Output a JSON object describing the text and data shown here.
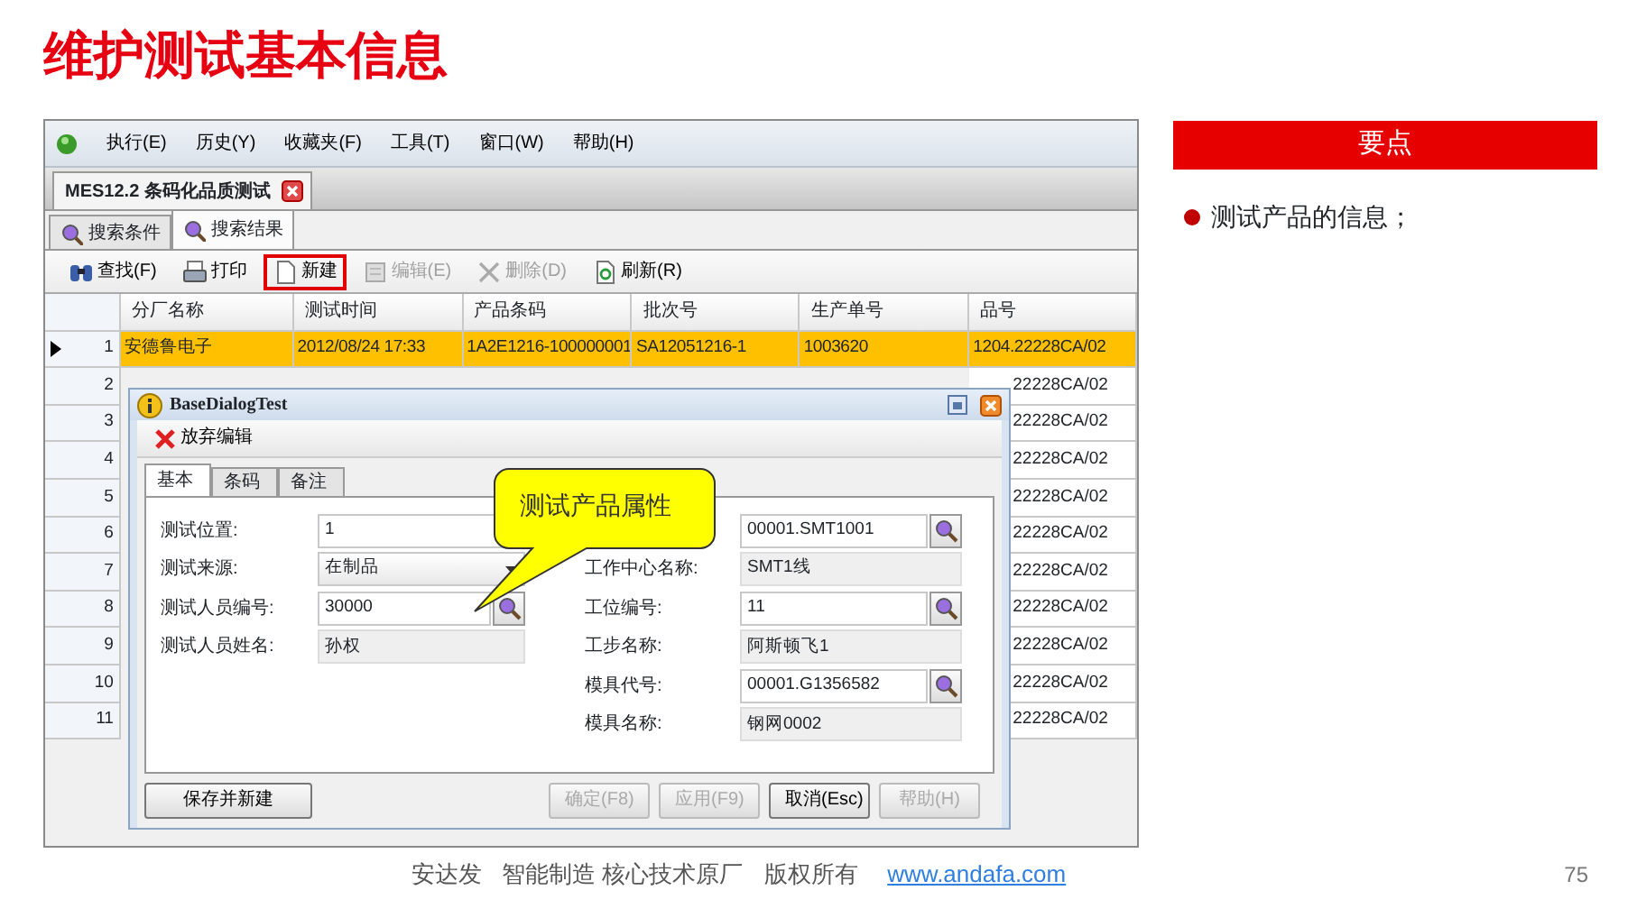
{
  "slide_title": "维护测试基本信息",
  "app": {
    "menu": [
      "执行(E)",
      "历史(Y)",
      "收藏夹(F)",
      "工具(T)",
      "窗口(W)",
      "帮助(H)"
    ],
    "document_tab": "MES12.2 条码化品质测试",
    "tabs": [
      {
        "label": "搜索条件",
        "selected": false
      },
      {
        "label": "搜索结果",
        "selected": true
      }
    ],
    "toolbar": [
      {
        "kind": "find",
        "label": "查找(F)",
        "disabled": false,
        "highlighted": false
      },
      {
        "kind": "print",
        "label": "打印",
        "disabled": false,
        "highlighted": false
      },
      {
        "kind": "new",
        "label": "新建",
        "disabled": false,
        "highlighted": true
      },
      {
        "kind": "edit",
        "label": "编辑(E)",
        "disabled": true,
        "highlighted": false
      },
      {
        "kind": "delete",
        "label": "删除(D)",
        "disabled": true,
        "highlighted": false
      },
      {
        "kind": "refresh",
        "label": "刷新(R)",
        "disabled": false,
        "highlighted": false
      }
    ],
    "grid": {
      "columns": [
        "分厂名称",
        "测试时间",
        "产品条码",
        "批次号",
        "生产单号",
        "品号"
      ],
      "rows": [
        {
          "number": "1",
          "selected": true,
          "cells": [
            "安德鲁电子",
            "2012/08/24 17:33",
            "1A2E1216-100000001",
            "SA12051216-1",
            "1003620",
            "1204.22228CA/02"
          ]
        },
        {
          "number": "2",
          "selected": false,
          "part_number": "22228CA/02"
        },
        {
          "number": "3",
          "selected": false,
          "part_number": "22228CA/02"
        },
        {
          "number": "4",
          "selected": false,
          "part_number": "22228CA/02"
        },
        {
          "number": "5",
          "selected": false,
          "part_number": "22228CA/02"
        },
        {
          "number": "6",
          "selected": false,
          "part_number": "22228CA/02"
        },
        {
          "number": "7",
          "selected": false,
          "part_number": "22228CA/02"
        },
        {
          "number": "8",
          "selected": false,
          "part_number": "22228CA/02"
        },
        {
          "number": "9",
          "selected": false,
          "part_number": "22228CA/02"
        },
        {
          "number": "10",
          "selected": false,
          "part_number": "22228CA/02"
        },
        {
          "number": "11",
          "selected": false,
          "part_number": "22228CA/02"
        }
      ]
    },
    "dialog": {
      "title": "BaseDialogTest",
      "toolbar_button": "放弃编辑",
      "tabs": [
        {
          "label": "基本",
          "selected": true
        },
        {
          "label": "条码",
          "selected": false
        },
        {
          "label": "备注",
          "selected": false
        }
      ],
      "left_fields": [
        {
          "label": "测试位置:",
          "value": "1",
          "kind": "text"
        },
        {
          "label": "测试来源:",
          "value": "在制品",
          "kind": "select"
        },
        {
          "label": "测试人员编号:",
          "value": "30000",
          "kind": "lookup"
        },
        {
          "label": "测试人员姓名:",
          "value": "孙权",
          "kind": "readonly"
        }
      ],
      "right_fields": [
        {
          "value": "00001.SMT1001",
          "kind": "lookup"
        },
        {
          "label": "工作中心名称:",
          "value": "SMT1线",
          "kind": "readonly"
        },
        {
          "label": "工位编号:",
          "value": "11",
          "kind": "lookup"
        },
        {
          "label": "工步名称:",
          "value": "阿斯顿飞1",
          "kind": "readonly"
        },
        {
          "label": "模具代号:",
          "value": "00001.G1356582",
          "kind": "lookup"
        },
        {
          "label": "模具名称:",
          "value": "钢网0002",
          "kind": "readonly"
        }
      ],
      "buttons": [
        {
          "label": "保存并新建",
          "disabled": false
        },
        {
          "label": "确定(F8)",
          "disabled": true
        },
        {
          "label": "应用(F9)",
          "disabled": true
        },
        {
          "label": "取消(Esc)",
          "disabled": false
        },
        {
          "label": "帮助(H)",
          "disabled": true
        }
      ]
    },
    "callout": "测试产品属性"
  },
  "key_points": {
    "heading": "要点",
    "items": [
      "测试产品的信息；"
    ]
  },
  "footer": {
    "texts": [
      "安达发",
      "智能制造 核心技术原厂",
      "版权所有"
    ],
    "link": "www.andafa.com",
    "page_number": "75"
  }
}
